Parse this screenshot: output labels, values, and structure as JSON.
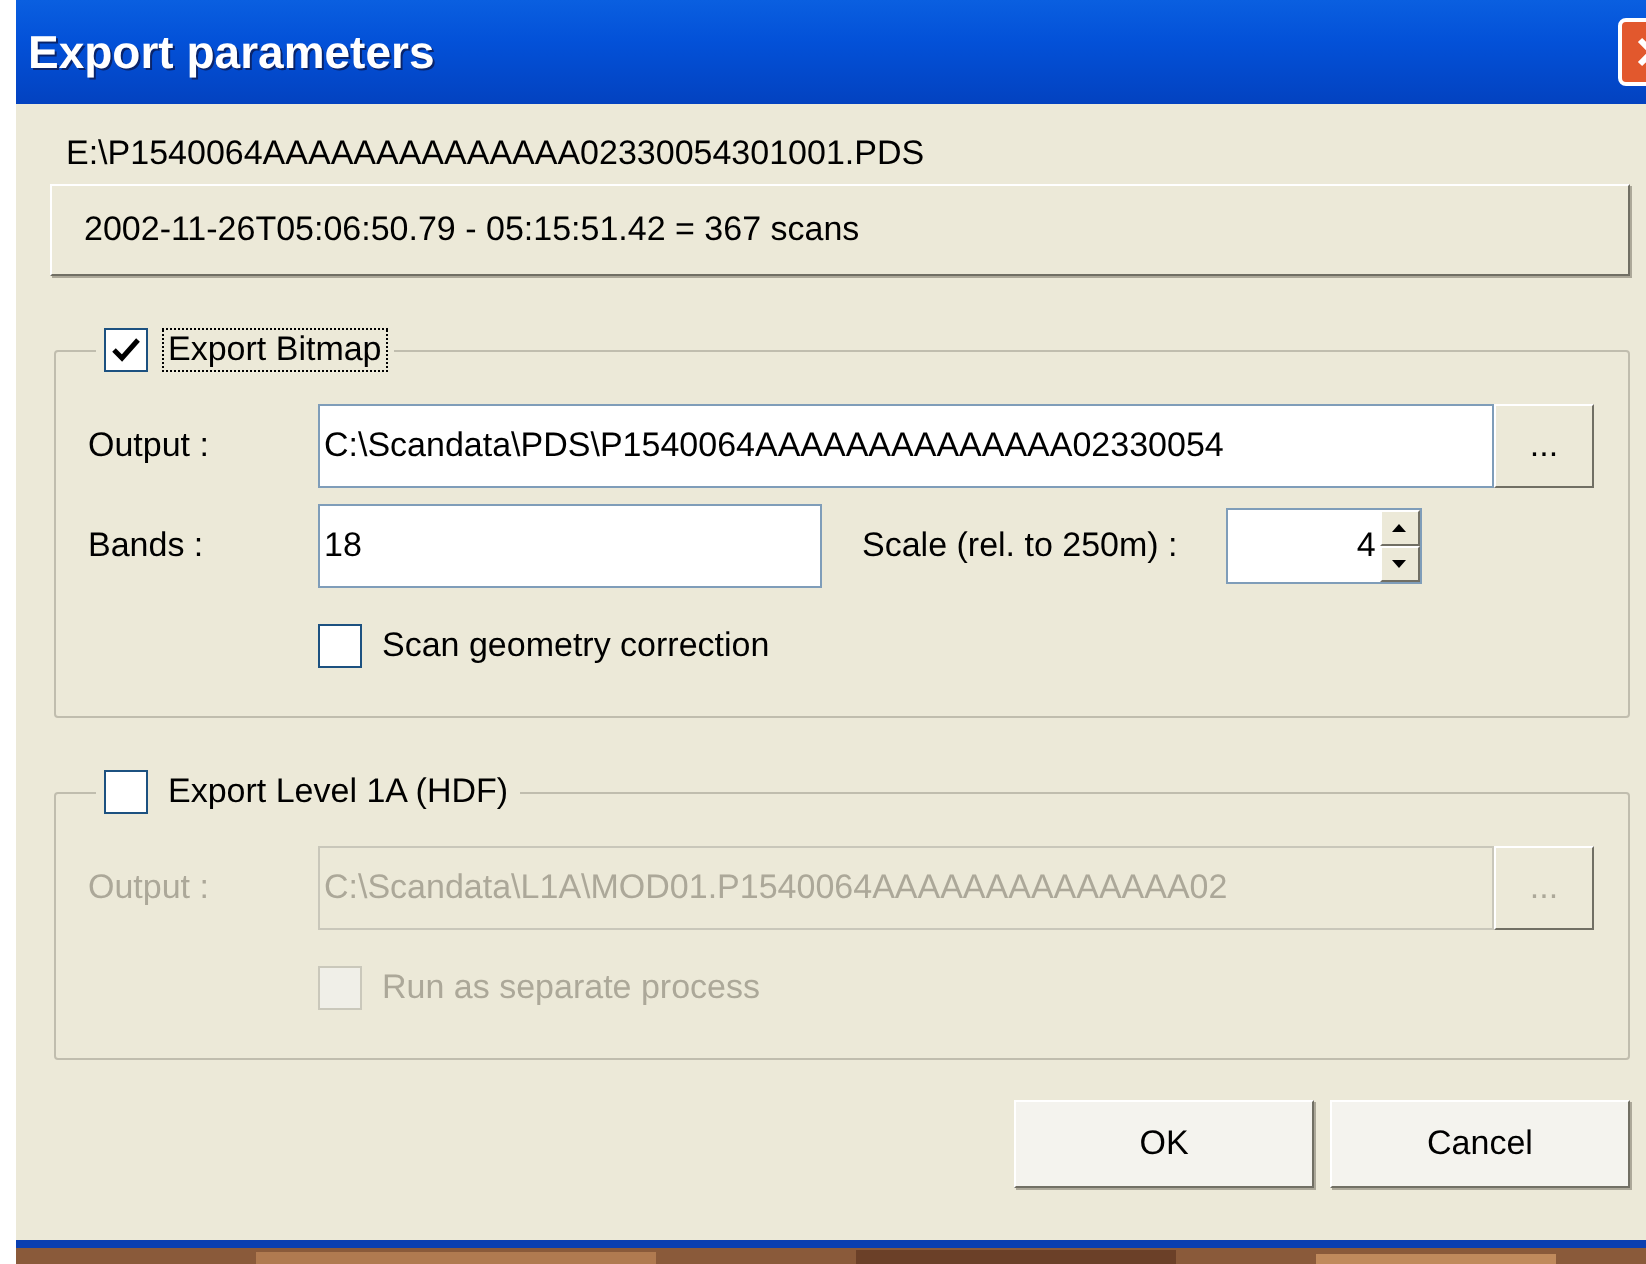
{
  "window": {
    "title": "Export parameters"
  },
  "file_path": "E:\\P1540064AAAAAAAAAAAAAA02330054301001.PDS",
  "scan_info_button": "2002-11-26T05:06:50.79 - 05:15:51.42 = 367 scans",
  "export_bitmap": {
    "label": "Export Bitmap",
    "checked": true,
    "disabled": false,
    "output_label": "Output :",
    "output": "C:\\Scandata\\PDS\\P1540064AAAAAAAAAAAAAA02330054",
    "browse": "...",
    "bands_label": "Bands :",
    "bands": "18",
    "scale_label": "Scale (rel. to 250m) :",
    "scale": "4",
    "option": {
      "label": "Scan geometry correction",
      "checked": false
    }
  },
  "export_l1a": {
    "label": "Export Level 1A (HDF)",
    "checked": false,
    "disabled": true,
    "output_label": "Output :",
    "output": "C:\\Scandata\\L1A\\MOD01.P1540064AAAAAAAAAAAAAA02",
    "browse": "...",
    "option": {
      "label": "Run as separate process",
      "checked": false
    }
  },
  "buttons": [
    "OK",
    "Cancel"
  ]
}
